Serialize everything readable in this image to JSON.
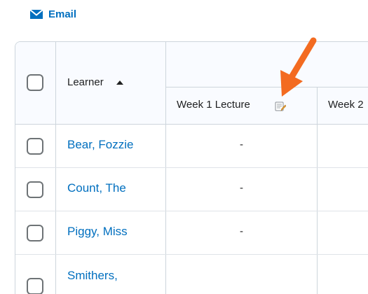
{
  "toolbar": {
    "email_label": "Email",
    "email_icon": "envelope-icon"
  },
  "grid": {
    "learner_header": "Learner",
    "sort_icon": "sort-ascending-icon",
    "columns": [
      {
        "label": "Week 1 Lecture",
        "icon": "edit-grade-icon"
      },
      {
        "label": "Week 2"
      }
    ],
    "rows": [
      {
        "name": "Bear, Fozzie",
        "week1": "-"
      },
      {
        "name": "Count, The",
        "week1": "-"
      },
      {
        "name": "Piggy, Miss",
        "week1": "-"
      },
      {
        "name": "Smithers,",
        "week1": ""
      }
    ]
  },
  "annotation": {
    "arrow_color": "#f36b21"
  },
  "colors": {
    "accent": "#006fbf",
    "border": "#cdd5dc",
    "header_bg": "#f9fbff"
  }
}
